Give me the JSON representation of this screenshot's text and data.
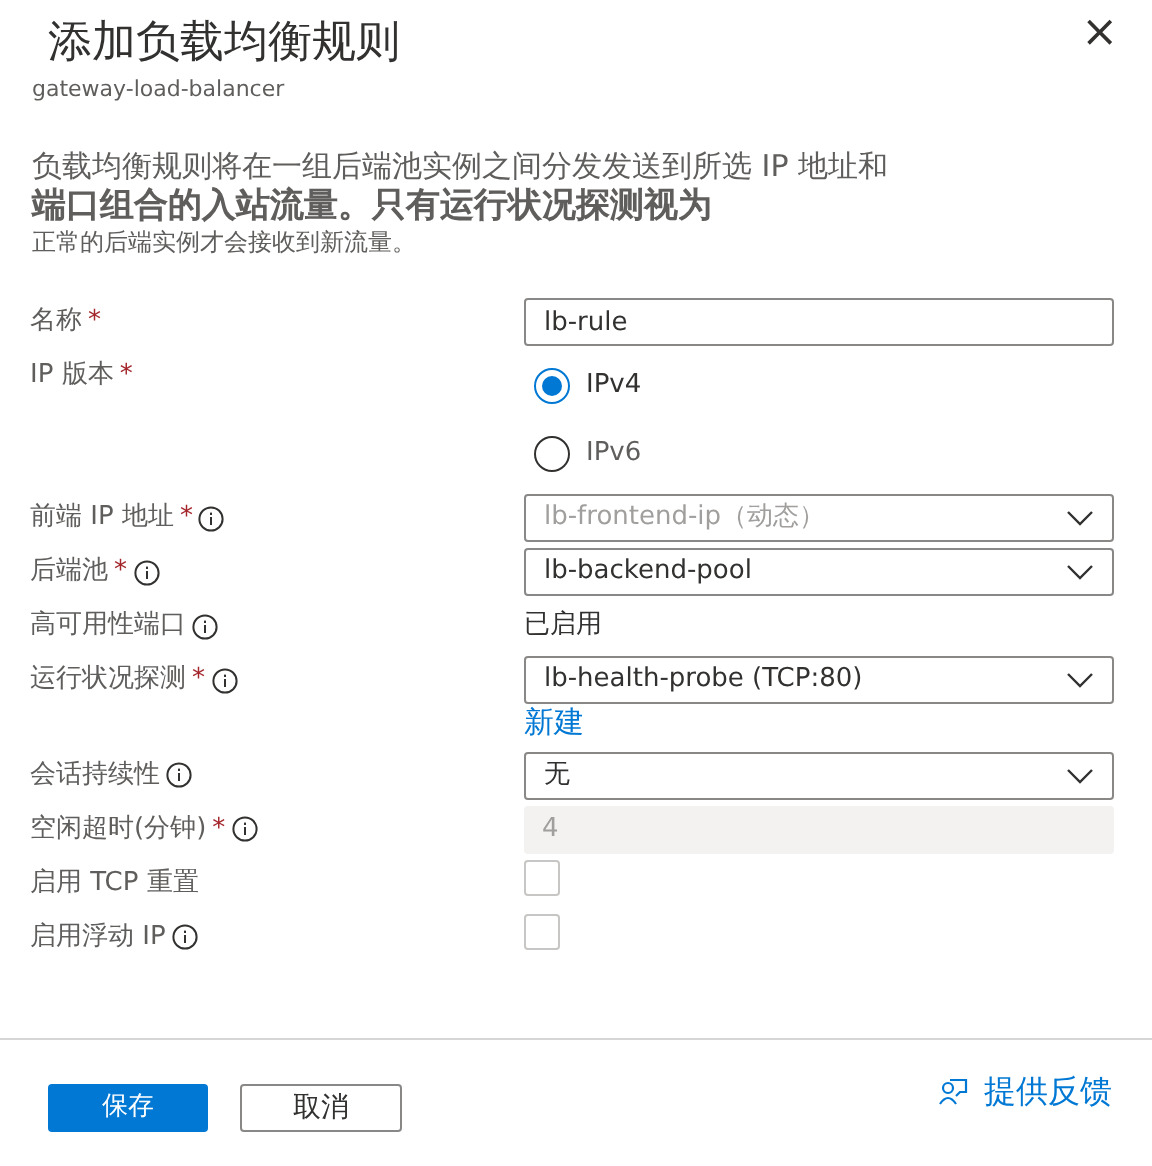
{
  "header": {
    "title": "添加负载均衡规则",
    "subtitle": "gateway-load-balancer",
    "close": "×"
  },
  "description": [
    "负载均衡规则将在一组后端池实例之间分发发送到所选 IP 地址和",
    "端口组合的入站流量。只有运行状况探测视为",
    "正常的后端实例才会接收到新流量。"
  ],
  "fields": [
    {
      "label": "名称",
      "required_mark": "*",
      "info": false,
      "kind": "text",
      "value": "lb-rule"
    },
    {
      "label": "IP 版本",
      "required_mark": "*",
      "info": false,
      "kind": "radio",
      "options": [
        {
          "label": "IPv4",
          "selected": true
        },
        {
          "label": "IPv6",
          "selected": false
        }
      ]
    },
    {
      "label": "前端 IP 地址",
      "required_mark": "*",
      "info": true,
      "kind": "dropdown",
      "value": "lb-frontend-ip（动态）",
      "disabled": true
    },
    {
      "label": "后端池",
      "required_mark": "*",
      "info": true,
      "kind": "dropdown",
      "value": "lb-backend-pool",
      "disabled": false
    },
    {
      "label": "高可用性端口",
      "info": true,
      "kind": "static",
      "value": "已启用"
    },
    {
      "label": "运行状况探测",
      "required_mark": "*",
      "info": true,
      "kind": "dropdown",
      "value": "lb-health-probe (TCP:80)",
      "disabled": false,
      "link": "新建"
    },
    {
      "label": "会话持续性",
      "info": true,
      "kind": "dropdown",
      "value": "无",
      "disabled": false
    },
    {
      "label": "空闲超时(分钟)",
      "required_mark": "*",
      "info": true,
      "kind": "readonly",
      "value": "4"
    },
    {
      "label": "启用 TCP 重置",
      "info": false,
      "kind": "checkbox",
      "checked": false
    },
    {
      "label": "启用浮动 IP",
      "info": true,
      "kind": "checkbox",
      "checked": false
    }
  ],
  "footer": {
    "save": "保存",
    "cancel": "取消",
    "feedback": "提供反馈"
  }
}
